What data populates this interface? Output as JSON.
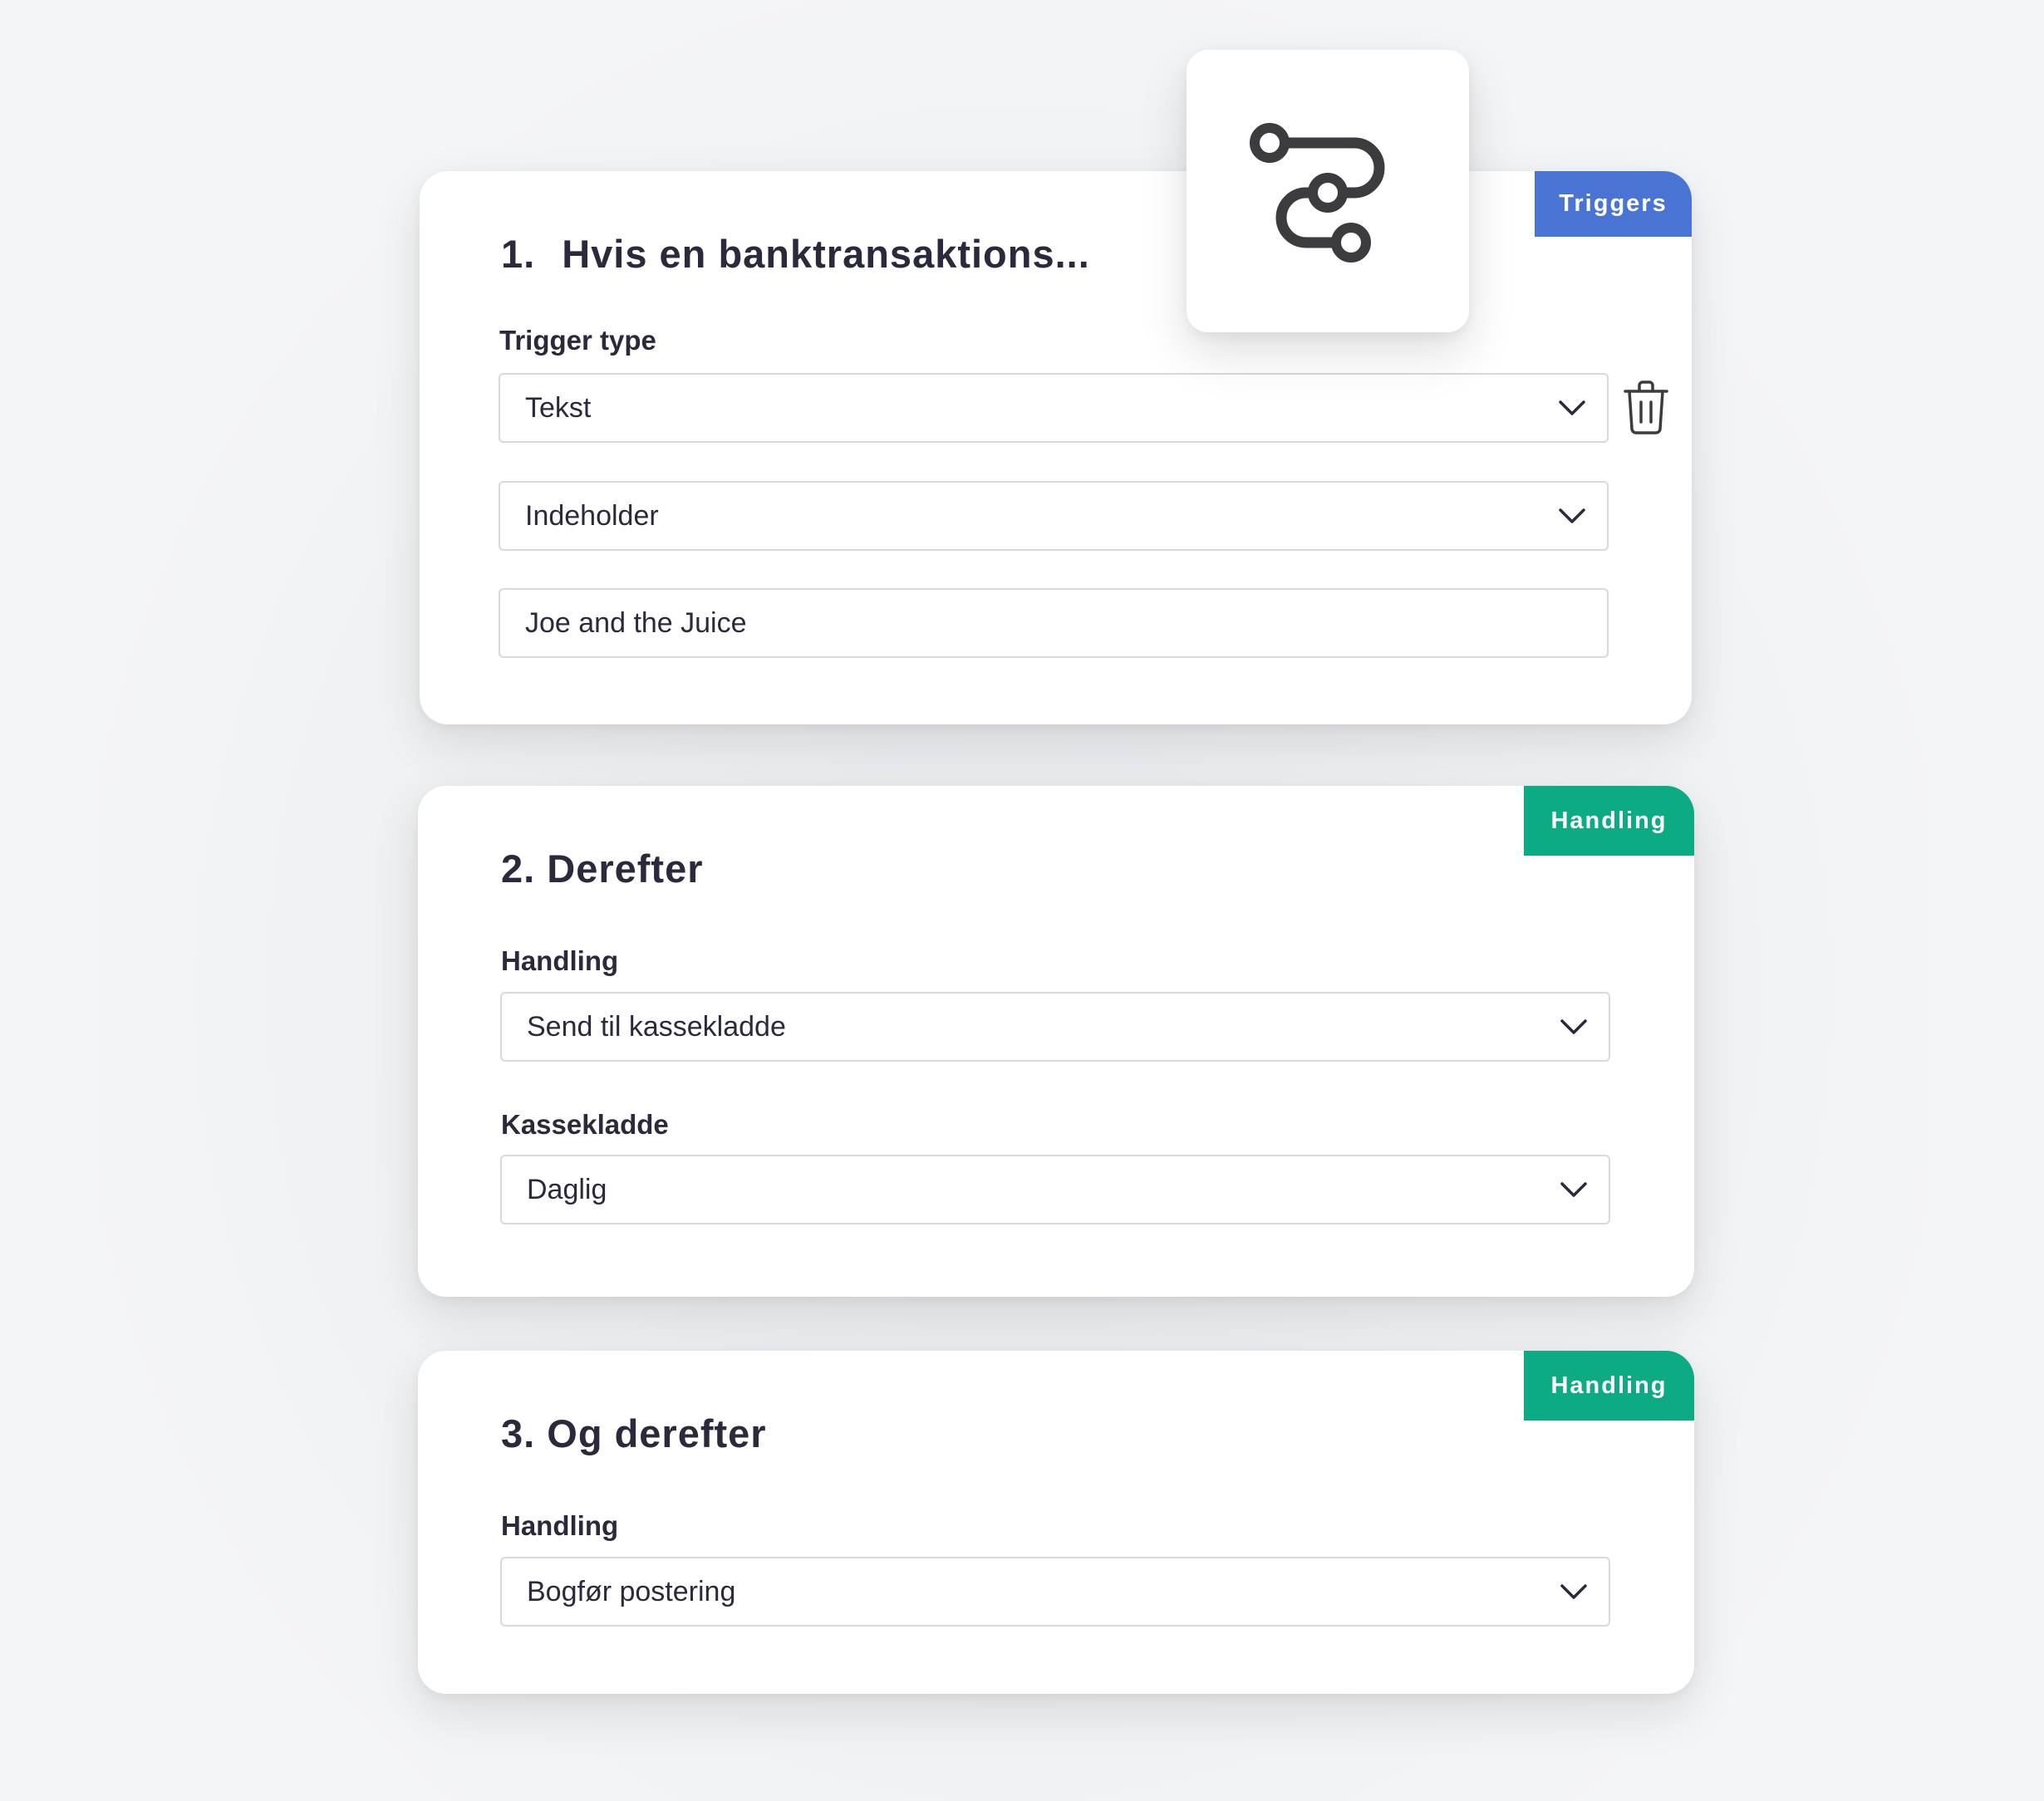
{
  "colors": {
    "trigger_tag": "#4a74d4",
    "action_tag": "#0dab84",
    "text": "#2a2a3c",
    "field_border": "#d7d9de",
    "icon": "#3c3c3e"
  },
  "workflow_icon": "route-flow-icon",
  "trigger_card": {
    "tag": "Triggers",
    "number": "1.",
    "title": "Hvis en banktransaktions...",
    "trigger_type_label": "Trigger type",
    "trigger_type_value": "Tekst",
    "condition_value": "Indeholder",
    "text_value": "Joe and the Juice",
    "delete_icon": "trash-icon"
  },
  "action_card_1": {
    "tag": "Handling",
    "title": "2. Derefter",
    "action_label": "Handling",
    "action_value": "Send til kassekladde",
    "journal_label": "Kassekladde",
    "journal_value": "Daglig"
  },
  "action_card_2": {
    "tag": "Handling",
    "title": "3. Og derefter",
    "action_label": "Handling",
    "action_value": "Bogfør postering"
  }
}
